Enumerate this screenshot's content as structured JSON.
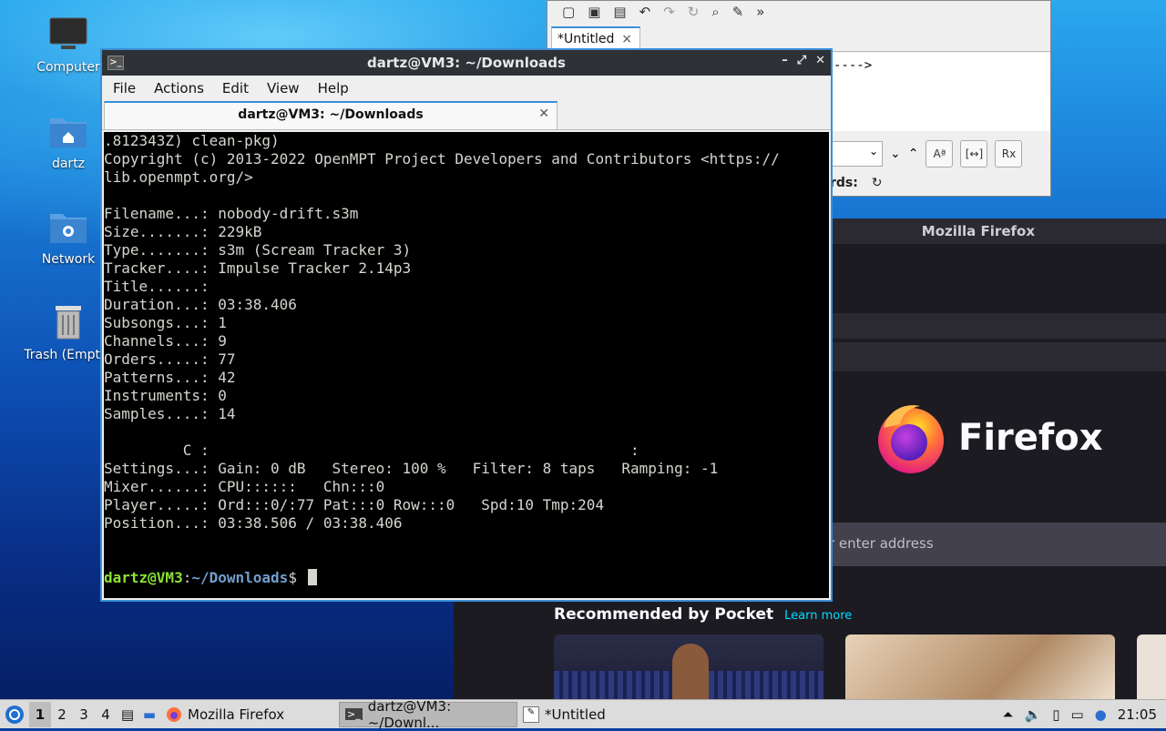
{
  "desktop": {
    "icons": [
      {
        "label": "Computer"
      },
      {
        "label": "dartz"
      },
      {
        "label": "Network"
      },
      {
        "label": "Trash (Empty)"
      }
    ]
  },
  "editor": {
    "tab_label": "*Untitled",
    "doc_text": "---->",
    "find_label": "rds:",
    "btn_case": "Aª",
    "btn_word": "[↔]",
    "btn_regex": "Rx"
  },
  "firefox": {
    "window_title": "Mozilla Firefox",
    "brand": "Firefox",
    "search_placeholder": "r enter address",
    "pocket_heading": "Recommended by Pocket",
    "pocket_learn_more": "Learn more"
  },
  "terminal": {
    "window_title": "dartz@VM3: ~/Downloads",
    "menu": [
      "File",
      "Actions",
      "Edit",
      "View",
      "Help"
    ],
    "tab_label": "dartz@VM3: ~/Downloads",
    "lines": [
      ".812343Z) clean-pkg)",
      "Copyright (c) 2013-2022 OpenMPT Project Developers and Contributors <https://",
      "lib.openmpt.org/>",
      "",
      "Filename...: nobody-drift.s3m",
      "Size.......: 229kB",
      "Type.......: s3m (Scream Tracker 3)",
      "Tracker....: Impulse Tracker 2.14p3",
      "Title......:",
      "Duration...: 03:38.406",
      "Subsongs...: 1",
      "Channels...: 9",
      "Orders.....: 77",
      "Patterns...: 42",
      "Instruments: 0",
      "Samples....: 14",
      "",
      "         C :                                                :",
      "Settings...: Gain: 0 dB   Stereo: 100 %   Filter: 8 taps   Ramping: -1",
      "Mixer......: CPU::::::   Chn:::0",
      "Player.....: Ord:::0/:77 Pat:::0 Row:::0   Spd:10 Tmp:204",
      "Position...: 03:38.506 / 03:38.406",
      "",
      ""
    ],
    "prompt_user": "dartz@VM3",
    "prompt_sep": ":",
    "prompt_path": "~/Downloads",
    "prompt_symbol": "$ "
  },
  "taskbar": {
    "workspaces": [
      "1",
      "2",
      "3",
      "4"
    ],
    "tasks": [
      {
        "label": "Mozilla Firefox"
      },
      {
        "label": "dartz@VM3: ~/Downl..."
      },
      {
        "label": "*Untitled"
      }
    ],
    "clock": "21:05"
  }
}
